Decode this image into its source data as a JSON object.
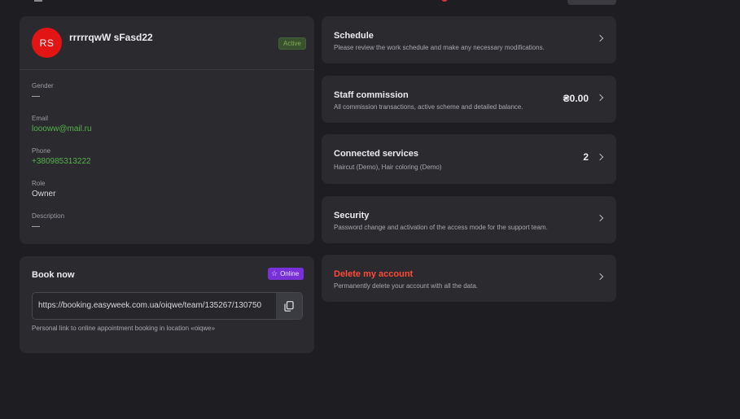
{
  "profile": {
    "initials": "RS",
    "name": "rrrrrqwW sFasd22",
    "status": "Active",
    "fields": [
      {
        "label": "Gender",
        "value": "—"
      },
      {
        "label": "Email",
        "value": "loooww@mail.ru"
      },
      {
        "label": "Phone",
        "value": "+380985313222"
      },
      {
        "label": "Role",
        "value": "Owner"
      },
      {
        "label": "Description",
        "value": "—"
      }
    ]
  },
  "book": {
    "title": "Book now",
    "badge": "Online",
    "link": "https://booking.easyweek.com.ua/oiqwe/team/135267/130750",
    "caption": "Personal link to online appointment booking in location «oiqwe»"
  },
  "rows": {
    "schedule": {
      "title": "Schedule",
      "desc": "Please review the work schedule and make any necessary modifications."
    },
    "commission": {
      "title": "Staff commission",
      "desc": "All commission transactions, active scheme and detailed balance.",
      "value": "₴0.00"
    },
    "services": {
      "title": "Connected services",
      "desc": "Haircut (Demo), Hair coloring (Demo)",
      "value": "2"
    },
    "security": {
      "title": "Security",
      "desc": "Password change and activation of the access mode for the support team."
    },
    "delete": {
      "title": "Delete my account",
      "desc": "Permanently delete your account with all the data."
    }
  },
  "colors": {
    "accent_red": "#e31414",
    "online_purple": "#7a30d8",
    "green_text": "#58b04e",
    "danger": "#ff4a3a"
  }
}
